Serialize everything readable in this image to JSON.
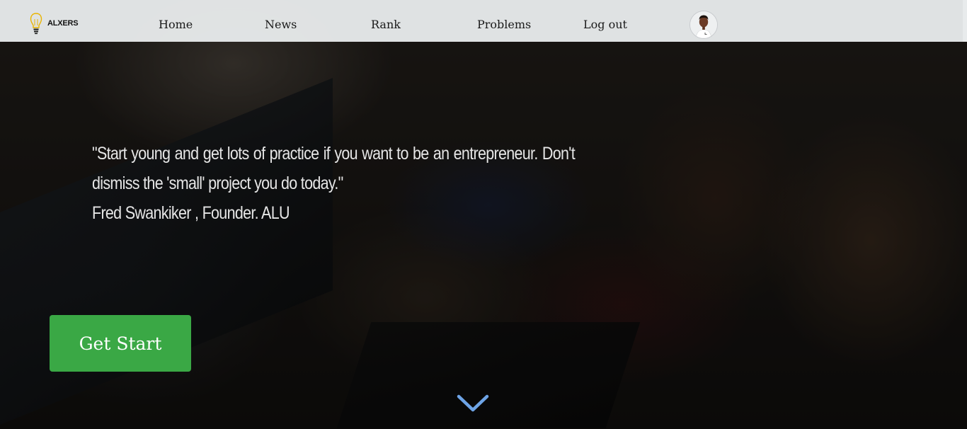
{
  "brand": {
    "name": "ALXERS",
    "logo_icon": "lightbulb-icon",
    "accent": "#e9b400"
  },
  "nav": {
    "items": [
      {
        "label": "Home"
      },
      {
        "label": "News"
      },
      {
        "label": "Rank"
      },
      {
        "label": "Problems"
      },
      {
        "label": "Log out"
      }
    ],
    "avatar_icon": "user-avatar"
  },
  "hero": {
    "quote": "\"Start young and get lots of practice if you want to be an entrepreneur. Don't dismiss the 'small' project you do today.\"",
    "author": "Fred Swankiker , Founder. ALU",
    "cta_label": "Get Start",
    "cta_color": "#3aa845",
    "scroll_icon": "chevron-down-icon",
    "scroll_color": "#6ea4e6"
  }
}
